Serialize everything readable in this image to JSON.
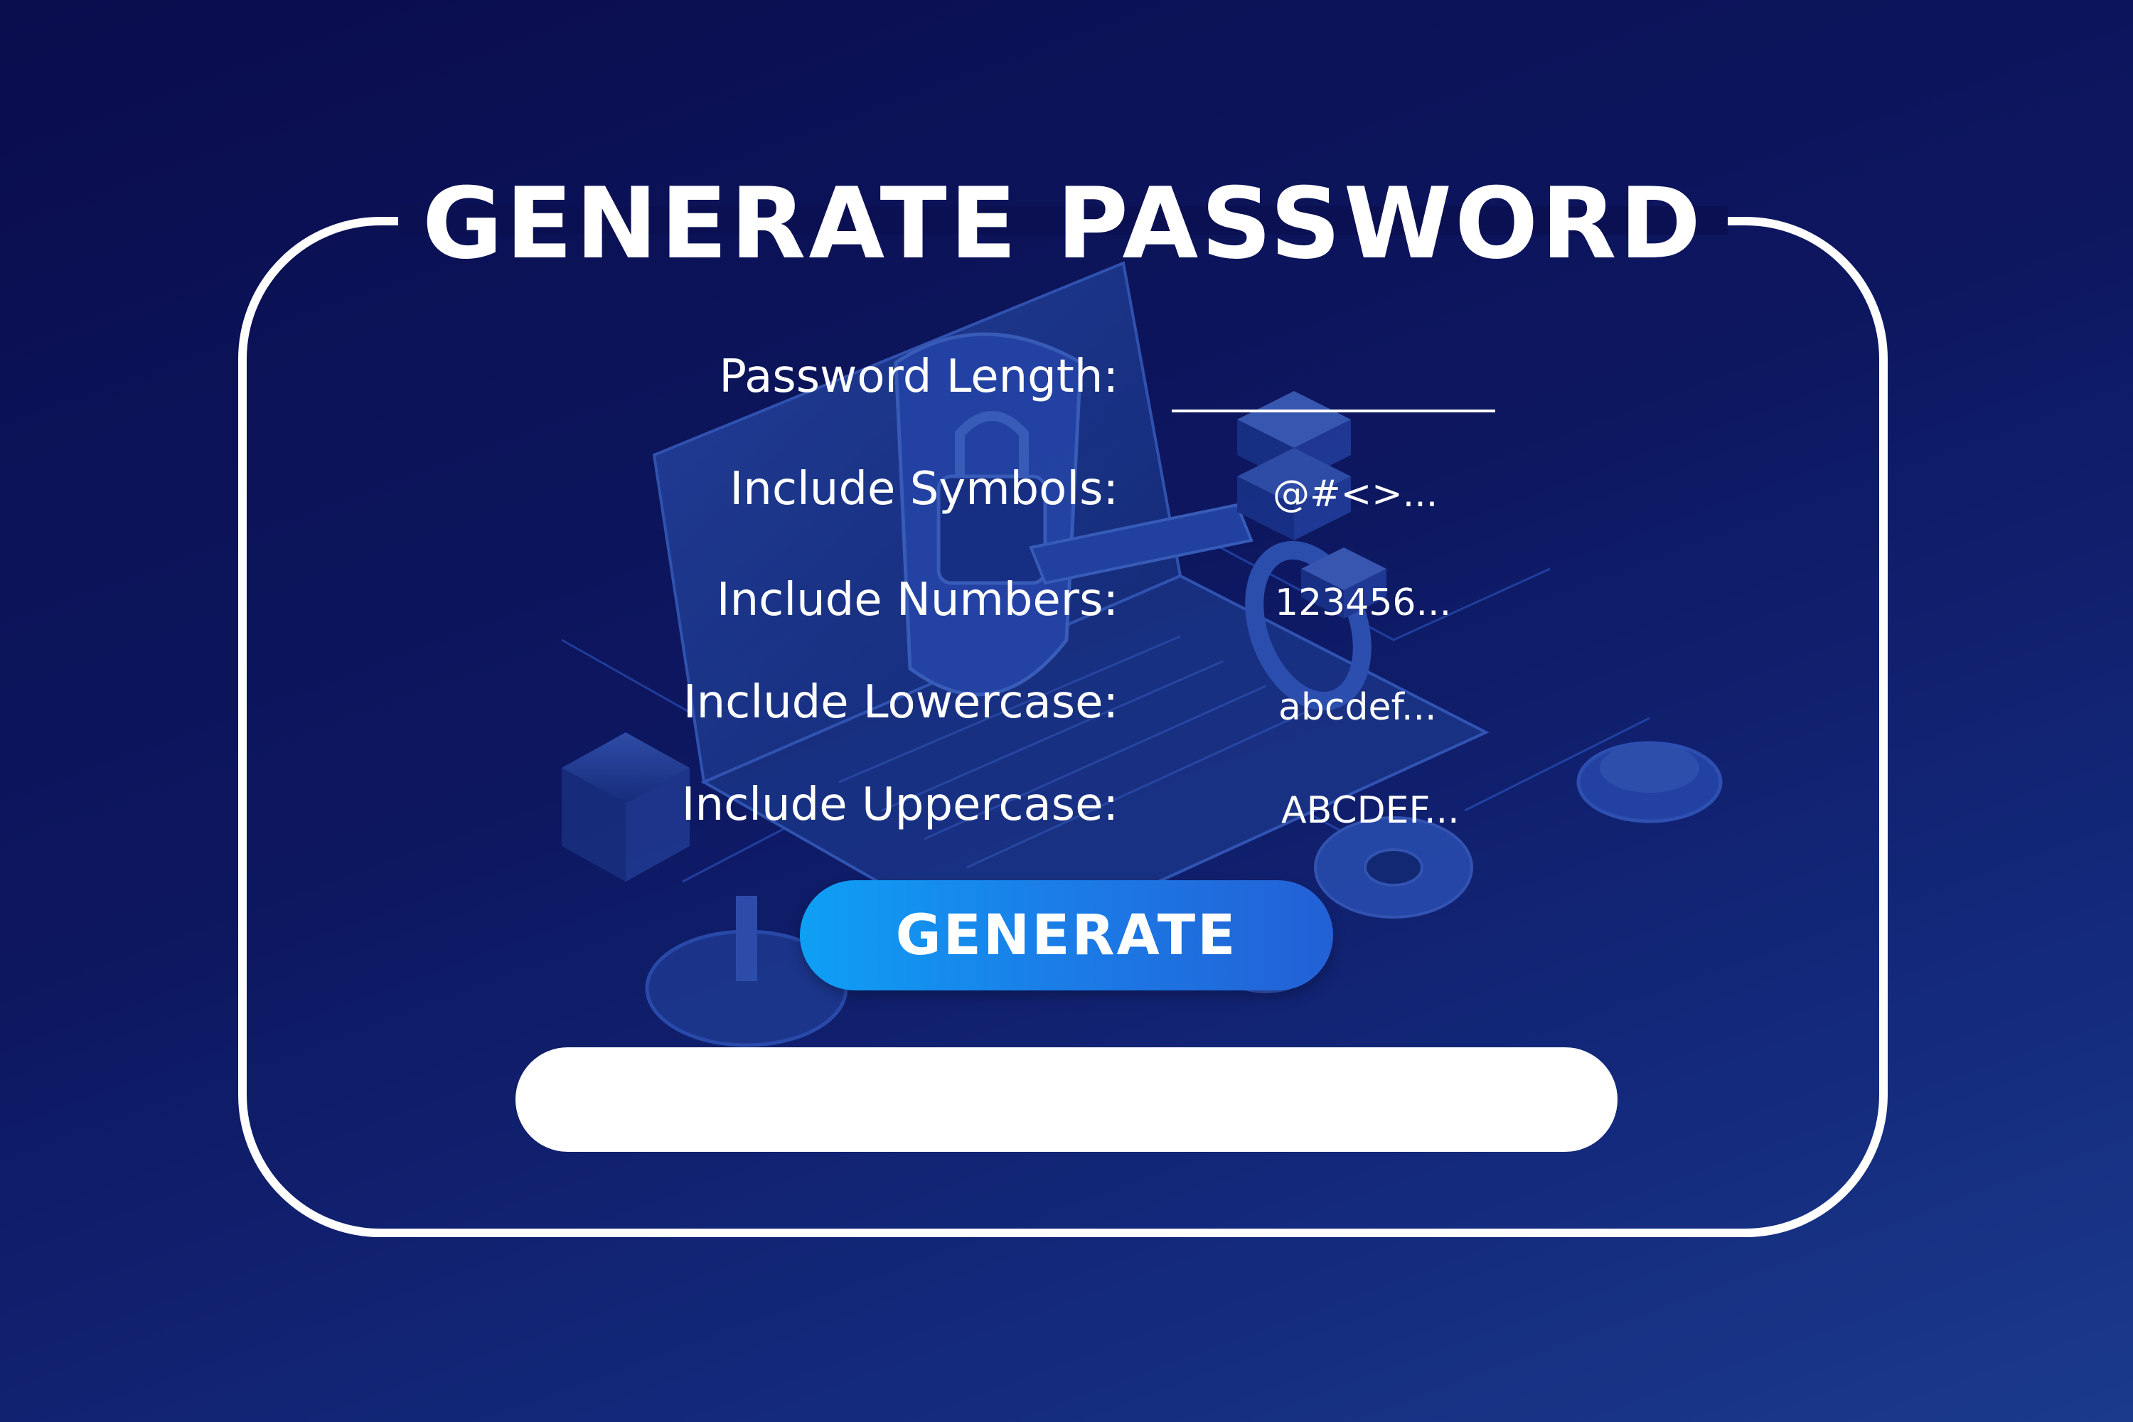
{
  "header": {
    "title": "GENERATE PASSWORD"
  },
  "form": {
    "length": {
      "label": "Password Length:",
      "value": ""
    },
    "symbols": {
      "label": "Include Symbols:",
      "option": "@#<>..."
    },
    "numbers": {
      "label": "Include Numbers:",
      "option": "123456..."
    },
    "lowercase": {
      "label": "Include Lowercase:",
      "option": "abcdef..."
    },
    "uppercase": {
      "label": "Include Uppercase:",
      "option": "ABCDEF..."
    }
  },
  "actions": {
    "generate_label": "GENERATE"
  },
  "output": {
    "value": ""
  },
  "theme": {
    "background": "#0b1052",
    "accent": "#1a7fe8",
    "text": "#ffffff"
  },
  "icons": [
    "laptop-icon",
    "shield-lock-icon",
    "key-icon",
    "server-icon",
    "gear-icon",
    "database-icon"
  ]
}
